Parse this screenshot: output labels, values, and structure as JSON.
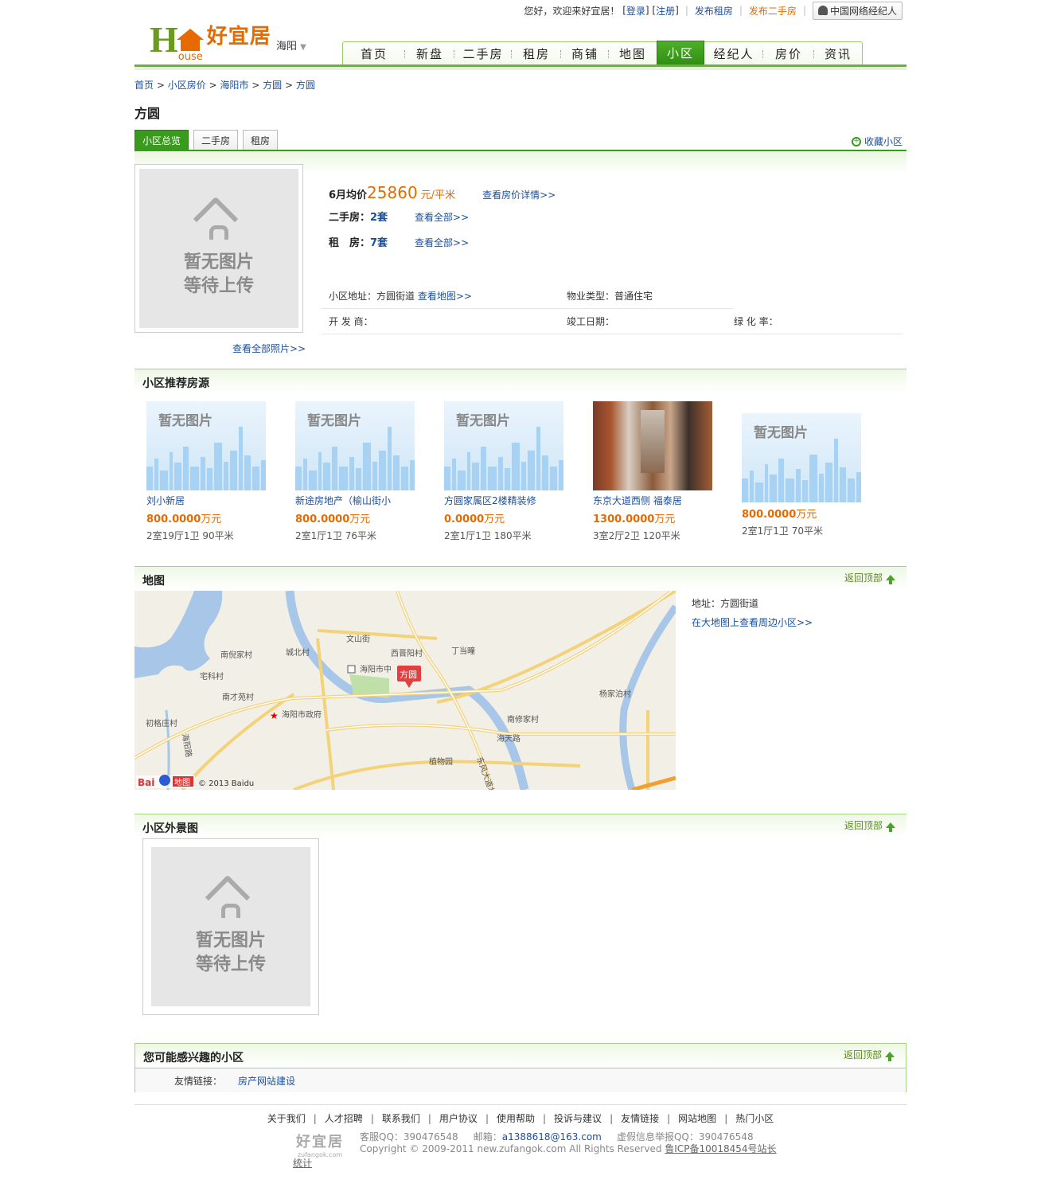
{
  "topbar": {
    "welcome": "您好，欢迎来好宜居！",
    "login": "登录",
    "register": "注册",
    "post_rent": "发布租房",
    "post_second": "发布二手房",
    "agent": "中国网络经纪人"
  },
  "logo": {
    "letter": "H",
    "ouse": "ouse",
    "name": "好宜居"
  },
  "city": "海阳",
  "nav": [
    "首页",
    "新盘",
    "二手房",
    "租房",
    "商铺",
    "地图",
    "小区",
    "经纪人",
    "房价",
    "资讯"
  ],
  "nav_active": "小区",
  "breadcrumb": [
    "首页",
    "小区房价",
    "海阳市",
    "方圆",
    "方圆"
  ],
  "title": "方圆",
  "tabs": [
    "小区总览",
    "二手房",
    "租房"
  ],
  "favorite": "收藏小区",
  "photo": {
    "line1": "暂无图片",
    "line2": "等待上传",
    "view_all": "查看全部照片>>"
  },
  "summary": {
    "price_label": "6月均价",
    "price": "25860",
    "unit": "元/平米",
    "price_link": "查看房价详情>>",
    "second_label": "二手房：",
    "second_count": "2套",
    "rent_label": "租　房：",
    "rent_count": "7套",
    "view_all": "查看全部>>"
  },
  "info": {
    "address_label": "小区地址：",
    "address": "方圆街道",
    "map_link": "查看地图>>",
    "type_label": "物业类型：",
    "type": "普通住宅",
    "developer_label": "开 发 商：",
    "completed_label": "竣工日期：",
    "green_label": "绿 化 率："
  },
  "sections": {
    "recommend": "小区推荐房源",
    "map": "地图",
    "exterior": "小区外景图",
    "like": "您可能感兴趣的小区",
    "back_top": "返回顶部"
  },
  "listings": [
    {
      "name": "刘小新居",
      "price": "800.0000",
      "unit": "万元",
      "spec": "2室19厅1卫 90平米",
      "photo": false
    },
    {
      "name": "新途房地产（榆山街小",
      "price": "800.0000",
      "unit": "万元",
      "spec": "2室1厅1卫 76平米",
      "photo": false
    },
    {
      "name": "方圆家属区2楼精装修",
      "price": "0.0000",
      "unit": "万元",
      "spec": "2室1厅1卫 180平米",
      "photo": false
    },
    {
      "name": "东京大道西侧 福泰居",
      "price": "1300.0000",
      "unit": "万元",
      "spec": "3室2厅2卫 120平米",
      "photo": true
    },
    {
      "name": "",
      "price": "800.0000",
      "unit": "万元",
      "spec": "2室1厅1卫 70平米",
      "photo": false
    }
  ],
  "noimg_text": "暂无图片",
  "map": {
    "marker": "方圆",
    "labels": [
      "南倪家村",
      "城北村",
      "文山街",
      "西晋阳村",
      "丁当疃",
      "海阳市中",
      "宅科村",
      "南才苑村",
      "海阳市政府",
      "初格庄村",
      "南修家村",
      "杨家泊村",
      "海天路",
      "植物园",
      "东风大道北",
      "海阳路"
    ],
    "copyright": "© 2013 Baidu",
    "brand": "Bai 地图",
    "address_label": "地址：",
    "address": "方圆街道",
    "nearby_link": "在大地图上查看周边小区>>"
  },
  "links": {
    "label": "友情链接：",
    "items": [
      "房产网站建设"
    ]
  },
  "footer": {
    "nav": [
      "关于我们",
      "人才招聘",
      "联系我们",
      "用户协议",
      "使用帮助",
      "投诉与建议",
      "友情链接",
      "网站地图",
      "热门小区"
    ],
    "logo_big": "好宜居",
    "logo_small": "zufangok.com",
    "qq_label": "客服QQ：",
    "qq": "390476548",
    "mail_label": "邮箱：",
    "mail": "a1388618@163.com",
    "report_label": "虚假信息举报QQ：",
    "report_qq": "390476548",
    "copyright": "Copyright © 2009-2011 new.zufangok.com All Rights Reserved",
    "icp": "鲁ICP备10018454号站长",
    "stat": "统计"
  },
  "colors": {
    "green": "#3a9a1e",
    "orange": "#e66a00",
    "link": "#1a4f9c"
  }
}
